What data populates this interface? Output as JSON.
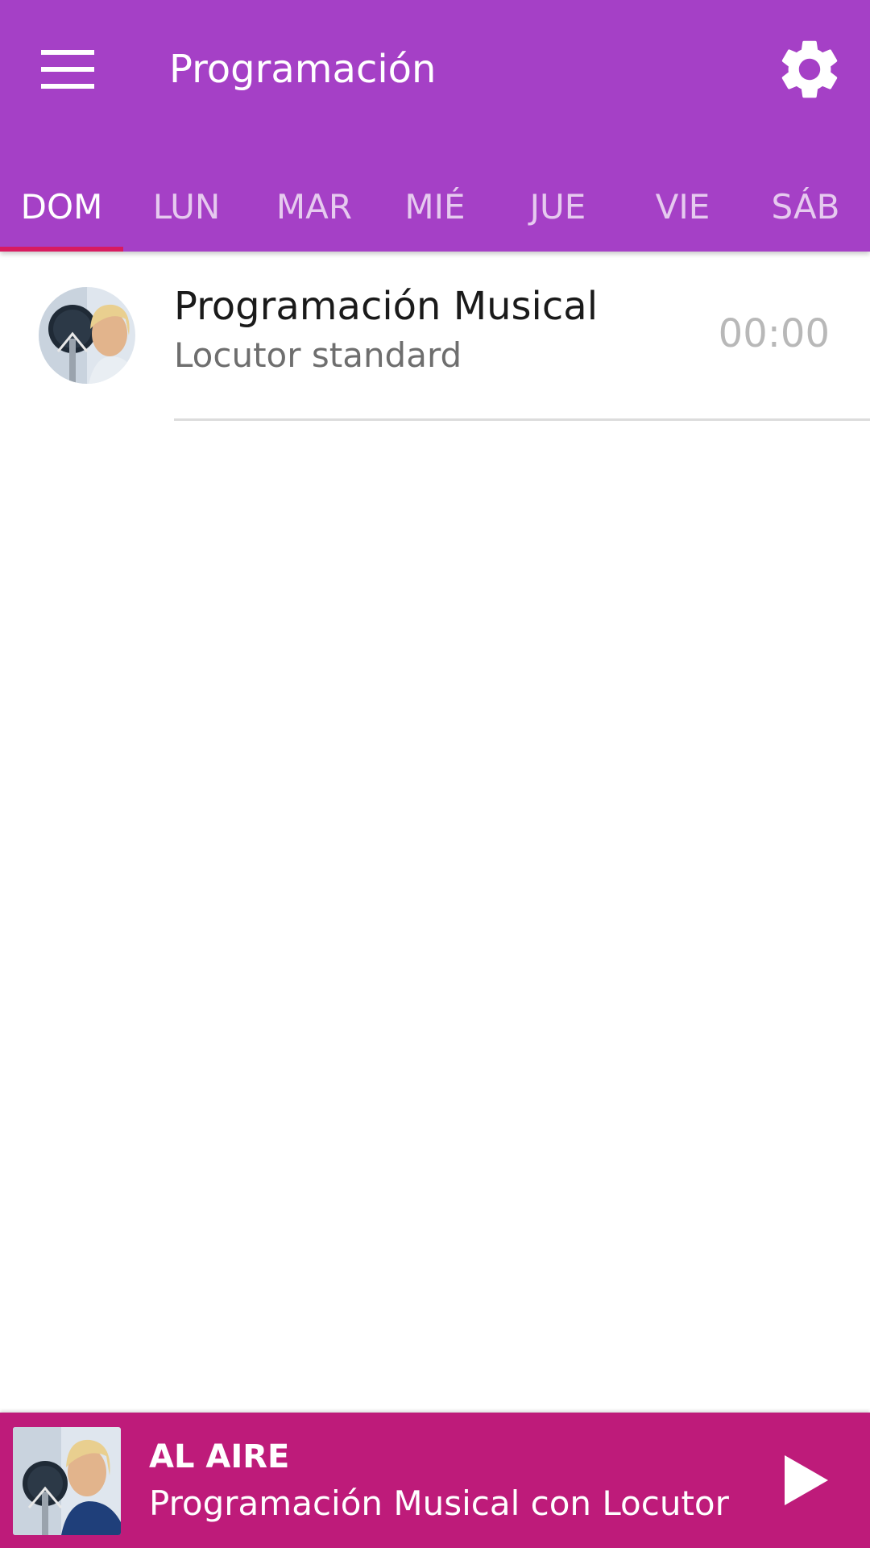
{
  "colors": {
    "app_bar": "#a540c6",
    "tab_indicator": "#d81b60",
    "player_bar": "#be1b7a",
    "divider": "#dcdcdc"
  },
  "app_bar": {
    "title": "Programación",
    "menu_icon": "hamburger-menu-icon",
    "settings_icon": "gear-icon"
  },
  "tabs": [
    {
      "label": "DOM",
      "selected": true
    },
    {
      "label": "LUN",
      "selected": false
    },
    {
      "label": "MAR",
      "selected": false
    },
    {
      "label": "MIÉ",
      "selected": false
    },
    {
      "label": "JUE",
      "selected": false
    },
    {
      "label": "VIE",
      "selected": false
    },
    {
      "label": "SÁB",
      "selected": false
    }
  ],
  "schedule": [
    {
      "title": "Programación Musical",
      "host": "Locutor standard",
      "time": "00:00",
      "avatar_icon": "host-avatar-image"
    }
  ],
  "now_playing": {
    "label": "AL AIRE",
    "track": "Programación Musical con Locutor ...",
    "thumbnail_icon": "host-thumbnail-image",
    "play_icon": "play-icon"
  }
}
